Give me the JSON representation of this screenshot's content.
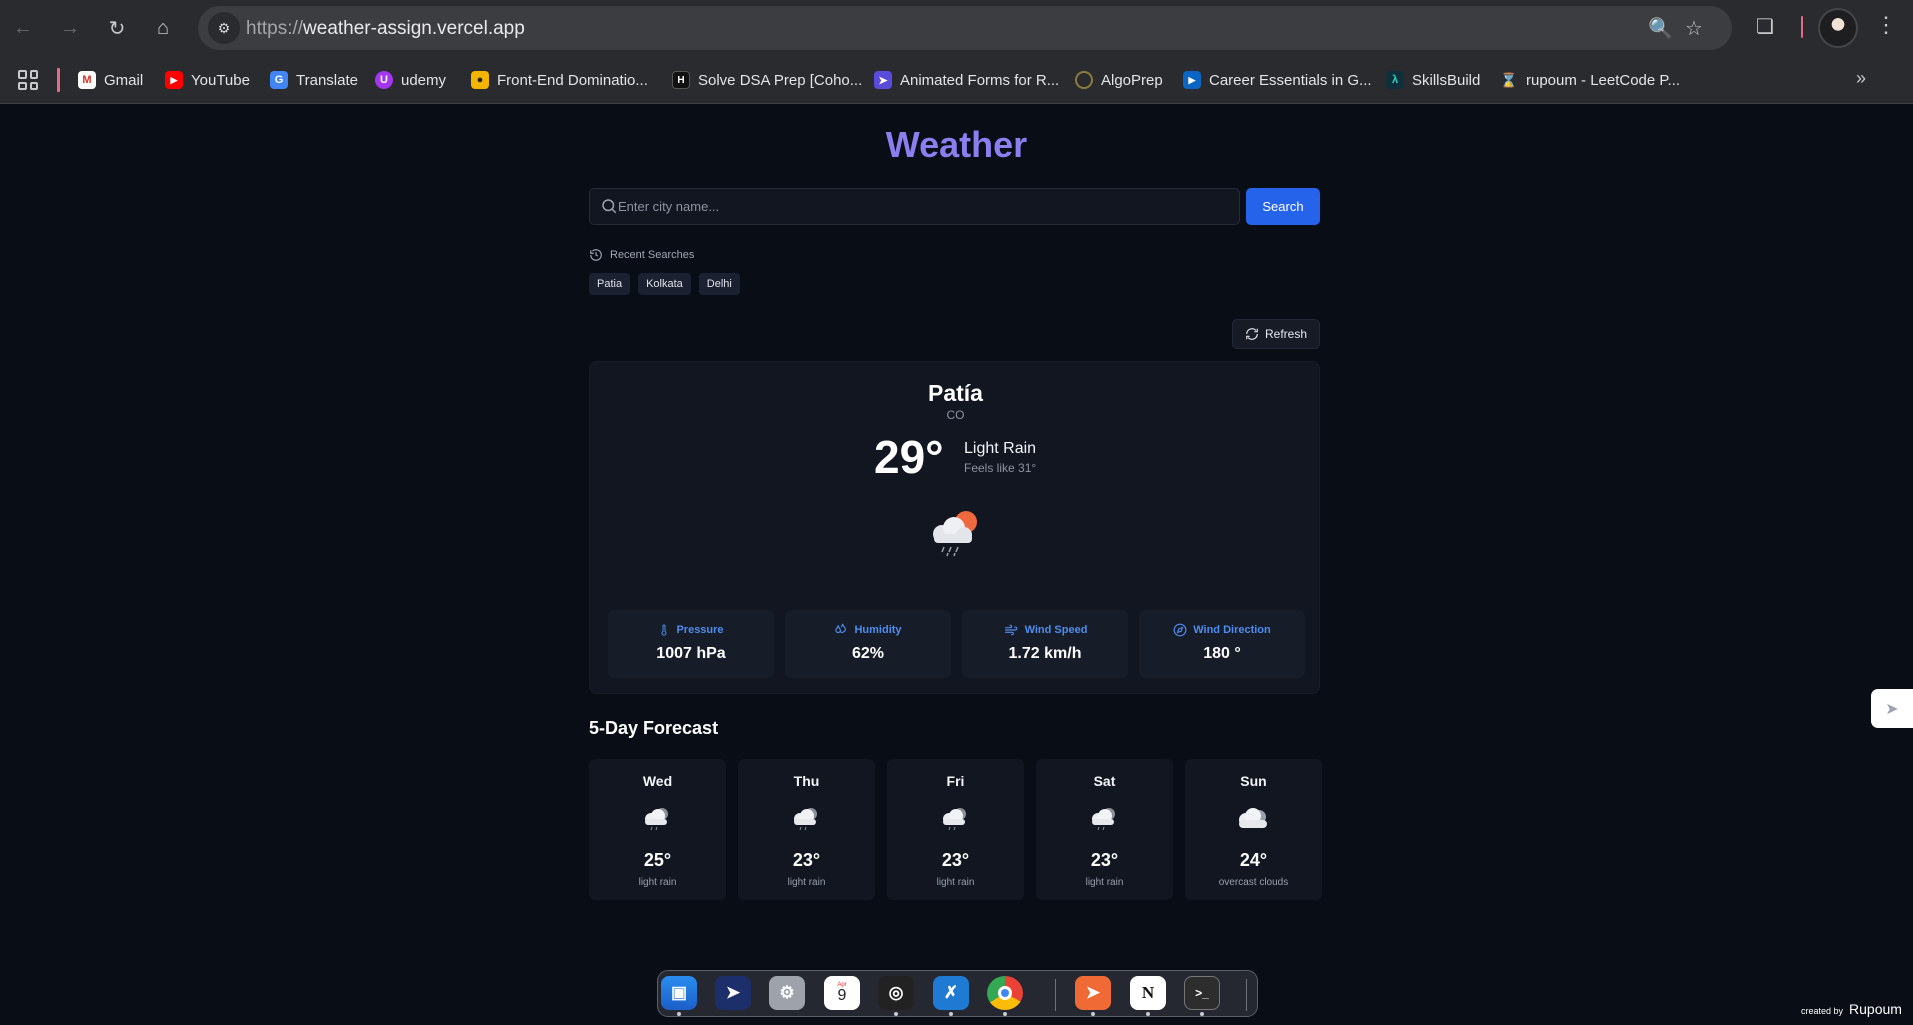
{
  "browser": {
    "url_scheme": "https://",
    "url_host": "weather-assign.vercel.app",
    "bookmarks": [
      {
        "label": "Gmail"
      },
      {
        "label": "YouTube"
      },
      {
        "label": "Translate"
      },
      {
        "label": "udemy"
      },
      {
        "label": "Front-End Dominatio..."
      },
      {
        "label": "Solve DSA Prep [Coho..."
      },
      {
        "label": "Animated Forms for R..."
      },
      {
        "label": "AlgoPrep"
      },
      {
        "label": "Career Essentials in G..."
      },
      {
        "label": "SkillsBuild"
      },
      {
        "label": "rupoum - LeetCode P..."
      }
    ]
  },
  "app": {
    "title": "Weather",
    "search": {
      "placeholder": "Enter city name...",
      "button": "Search"
    },
    "recent": {
      "heading": "Recent Searches",
      "items": [
        "Patia",
        "Kolkata",
        "Delhi"
      ]
    },
    "refresh_label": "Refresh",
    "current": {
      "city": "Patía",
      "country": "CO",
      "temp": "29°",
      "condition": "Light Rain",
      "feels_like": "Feels like 31°",
      "stats": [
        {
          "label": "Pressure",
          "value": "1007 hPa",
          "icon": "thermometer-icon"
        },
        {
          "label": "Humidity",
          "value": "62%",
          "icon": "droplets-icon"
        },
        {
          "label": "Wind Speed",
          "value": "1.72 km/h",
          "icon": "wind-icon"
        },
        {
          "label": "Wind Direction",
          "value": "180 °",
          "icon": "compass-icon"
        }
      ]
    },
    "forecast_title": "5-Day Forecast",
    "forecast": [
      {
        "day": "Wed",
        "temp": "25°",
        "desc": "light rain"
      },
      {
        "day": "Thu",
        "temp": "23°",
        "desc": "light rain"
      },
      {
        "day": "Fri",
        "temp": "23°",
        "desc": "light rain"
      },
      {
        "day": "Sat",
        "temp": "23°",
        "desc": "light rain"
      },
      {
        "day": "Sun",
        "temp": "24°",
        "desc": "overcast clouds"
      }
    ]
  },
  "dock": {
    "calendar_month": "Apr",
    "calendar_day": "9"
  },
  "credit": {
    "prefix": "created by",
    "name": "Rupoum"
  },
  "colors": {
    "accent": "#8b7ff0",
    "primary_button": "#2563eb",
    "stat_label": "#4f8cf0",
    "background": "#090d16"
  }
}
